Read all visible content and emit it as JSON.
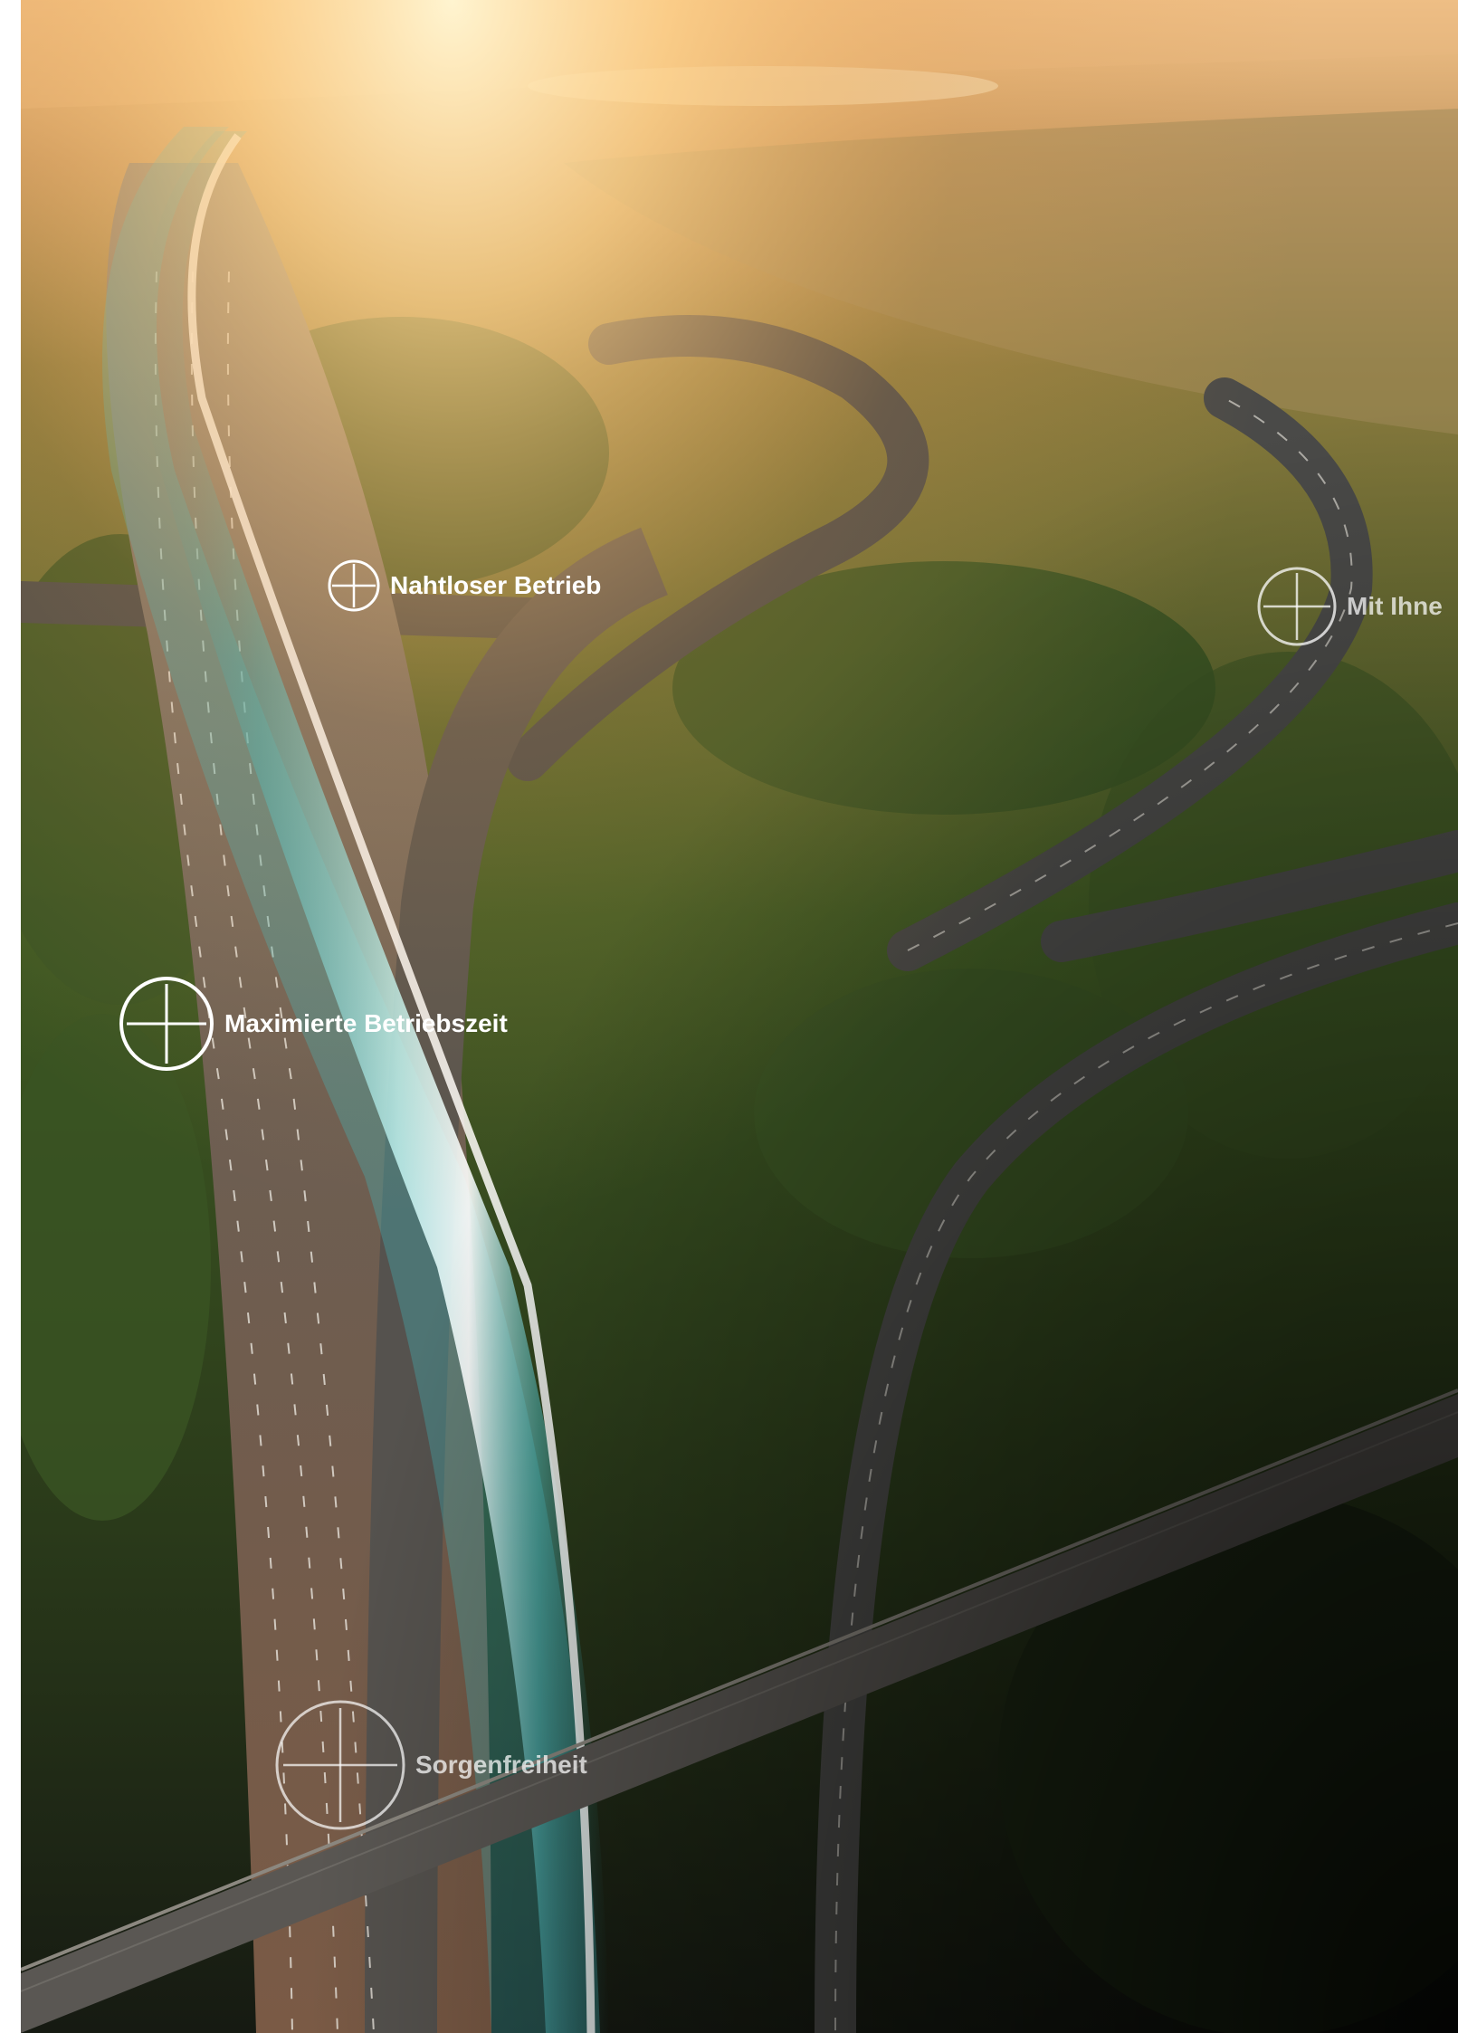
{
  "hotspots": [
    {
      "label": "Nahtloser Betrieb",
      "icon": "plus-circle-icon"
    },
    {
      "label": "Mit Ihne",
      "icon": "plus-circle-icon"
    },
    {
      "label": "Maximierte Betriebszeit",
      "icon": "plus-circle-icon"
    },
    {
      "label": "Sorgenfreiheit",
      "icon": "plus-circle-icon"
    }
  ],
  "colors": {
    "glow_teal": "#4fc3c7",
    "sun": "#ffe6b0",
    "foliage": "#2f4a1e",
    "road": "#3b3d40"
  }
}
